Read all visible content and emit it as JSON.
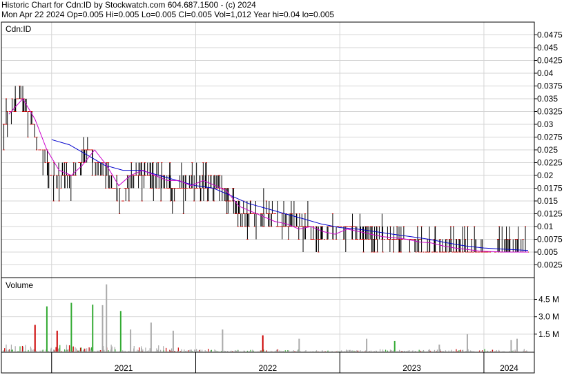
{
  "header": {
    "line1": "Historic Chart for Cdn:ID by Stockwatch.com 604.687.1500 - (c) 2024",
    "line2": "Mon Apr 22 2024   Op=0.005  Hi=0.005  Lo=0.005  Cl=0.005  Vol=1,012   Year hi=0.04   lo=0.005"
  },
  "chart_data": [
    {
      "type": "bar",
      "subtype": "ohlc-price",
      "title": "Cdn:ID",
      "ylim": [
        0,
        0.05
      ],
      "y_ticks": [
        "0.0475",
        "0.045",
        "0.0425",
        "0.04",
        "0.0375",
        "0.035",
        "0.0325",
        "0.03",
        "0.0275",
        "0.025",
        "0.0225",
        "0.02",
        "0.0175",
        "0.015",
        "0.0125",
        "0.01",
        "0.0075",
        "0.005",
        "0.0025"
      ],
      "y_tick_values": [
        0.0475,
        0.045,
        0.0425,
        0.04,
        0.0375,
        0.035,
        0.0325,
        0.03,
        0.0275,
        0.025,
        0.0225,
        0.02,
        0.0175,
        0.015,
        0.0125,
        0.01,
        0.0075,
        0.005,
        0.0025
      ],
      "x_start": "2020-09-01",
      "x_end": "2024-04-22",
      "grid": true,
      "colors": {
        "bars": "#000000",
        "close_marks": "#cc0000",
        "ma_short": "#cc00cc",
        "ma_long": "#0000cc"
      },
      "price_path": [
        [
          "2020-09-01",
          0.03
        ],
        [
          "2020-10-15",
          0.035
        ],
        [
          "2020-11-15",
          0.03
        ],
        [
          "2020-12-01",
          0.025
        ],
        [
          "2021-01-01",
          0.02
        ],
        [
          "2021-02-15",
          0.02
        ],
        [
          "2021-03-15",
          0.022
        ],
        [
          "2021-04-01",
          0.025
        ],
        [
          "2021-05-01",
          0.022
        ],
        [
          "2021-06-01",
          0.018
        ],
        [
          "2021-07-01",
          0.016
        ],
        [
          "2021-08-01",
          0.02
        ],
        [
          "2021-09-15",
          0.02
        ],
        [
          "2021-11-01",
          0.018
        ],
        [
          "2021-12-01",
          0.018
        ],
        [
          "2022-01-15",
          0.018
        ],
        [
          "2022-03-01",
          0.018
        ],
        [
          "2022-04-01",
          0.015
        ],
        [
          "2022-05-01",
          0.012
        ],
        [
          "2022-06-01",
          0.012
        ],
        [
          "2022-07-01",
          0.012
        ],
        [
          "2022-08-01",
          0.011
        ],
        [
          "2022-09-01",
          0.01
        ],
        [
          "2022-10-01",
          0.01
        ],
        [
          "2022-11-01",
          0.008
        ],
        [
          "2022-12-01",
          0.009
        ],
        [
          "2023-01-01",
          0.01
        ],
        [
          "2023-02-01",
          0.009
        ],
        [
          "2023-03-01",
          0.008
        ],
        [
          "2023-04-01",
          0.008
        ],
        [
          "2023-05-01",
          0.0075
        ],
        [
          "2023-06-01",
          0.007
        ],
        [
          "2023-07-01",
          0.007
        ],
        [
          "2023-08-01",
          0.006
        ],
        [
          "2023-09-01",
          0.006
        ],
        [
          "2023-10-01",
          0.0055
        ],
        [
          "2023-11-01",
          0.0055
        ],
        [
          "2023-12-01",
          0.005
        ],
        [
          "2024-01-01",
          0.005
        ],
        [
          "2024-02-01",
          0.005
        ],
        [
          "2024-03-01",
          0.005
        ],
        [
          "2024-04-22",
          0.005
        ]
      ],
      "ma_short_path": [
        [
          "2020-09-15",
          0.032
        ],
        [
          "2020-10-20",
          0.035
        ],
        [
          "2020-11-20",
          0.031
        ],
        [
          "2020-12-20",
          0.025
        ],
        [
          "2021-01-20",
          0.021
        ],
        [
          "2021-02-20",
          0.02
        ],
        [
          "2021-03-20",
          0.022
        ],
        [
          "2021-04-20",
          0.025
        ],
        [
          "2021-05-20",
          0.022
        ],
        [
          "2021-06-20",
          0.018
        ],
        [
          "2021-07-20",
          0.02
        ],
        [
          "2021-08-20",
          0.021
        ],
        [
          "2021-09-20",
          0.02
        ],
        [
          "2021-10-20",
          0.019
        ],
        [
          "2021-11-20",
          0.019
        ],
        [
          "2021-12-20",
          0.018
        ],
        [
          "2022-01-20",
          0.019
        ],
        [
          "2022-02-20",
          0.018
        ],
        [
          "2022-03-20",
          0.017
        ],
        [
          "2022-04-20",
          0.014
        ],
        [
          "2022-05-20",
          0.013
        ],
        [
          "2022-06-20",
          0.012
        ],
        [
          "2022-07-20",
          0.011
        ],
        [
          "2022-08-20",
          0.0105
        ],
        [
          "2022-09-20",
          0.0095
        ],
        [
          "2022-10-20",
          0.01
        ],
        [
          "2022-11-20",
          0.009
        ],
        [
          "2022-12-20",
          0.0085
        ],
        [
          "2023-01-20",
          0.0095
        ],
        [
          "2023-02-20",
          0.009
        ],
        [
          "2023-03-20",
          0.0085
        ],
        [
          "2023-04-20",
          0.008
        ],
        [
          "2023-05-20",
          0.0078
        ],
        [
          "2023-06-20",
          0.0075
        ],
        [
          "2023-07-20",
          0.007
        ],
        [
          "2023-08-20",
          0.0068
        ],
        [
          "2023-09-20",
          0.0062
        ],
        [
          "2023-10-20",
          0.0058
        ],
        [
          "2023-11-20",
          0.0055
        ],
        [
          "2023-12-20",
          0.0052
        ],
        [
          "2024-01-20",
          0.0051
        ],
        [
          "2024-02-20",
          0.005
        ],
        [
          "2024-03-20",
          0.005
        ],
        [
          "2024-04-22",
          0.005
        ]
      ],
      "ma_long_path": [
        [
          "2021-01-01",
          0.027
        ],
        [
          "2021-02-15",
          0.026
        ],
        [
          "2021-04-01",
          0.024
        ],
        [
          "2021-05-15",
          0.022
        ],
        [
          "2021-07-01",
          0.021
        ],
        [
          "2021-08-15",
          0.021
        ],
        [
          "2021-10-01",
          0.02
        ],
        [
          "2021-11-15",
          0.019
        ],
        [
          "2022-01-01",
          0.018
        ],
        [
          "2022-02-15",
          0.0175
        ],
        [
          "2022-04-01",
          0.016
        ],
        [
          "2022-05-15",
          0.0145
        ],
        [
          "2022-07-01",
          0.0135
        ],
        [
          "2022-08-15",
          0.0125
        ],
        [
          "2022-10-01",
          0.0115
        ],
        [
          "2022-11-15",
          0.0105
        ],
        [
          "2023-01-01",
          0.0098
        ],
        [
          "2023-02-15",
          0.0095
        ],
        [
          "2023-04-01",
          0.009
        ],
        [
          "2023-05-15",
          0.0085
        ],
        [
          "2023-07-01",
          0.008
        ],
        [
          "2023-08-15",
          0.0075
        ],
        [
          "2023-10-01",
          0.0068
        ],
        [
          "2023-11-15",
          0.0062
        ],
        [
          "2024-01-01",
          0.0058
        ],
        [
          "2024-02-15",
          0.0056
        ],
        [
          "2024-04-01",
          0.0054
        ],
        [
          "2024-04-22",
          0.0053
        ]
      ]
    },
    {
      "type": "bar",
      "subtype": "volume",
      "title": "Volume",
      "ylim": [
        0,
        6200000
      ],
      "y_ticks": [
        "4.5 M",
        "3.0 M",
        "1.5 M"
      ],
      "y_tick_values": [
        4500000,
        3000000,
        1500000
      ],
      "colors": {
        "up": "#33aa33",
        "down": "#cc0000",
        "flat": "#aaaaaa"
      },
      "spikes": [
        {
          "date": "2020-11-20",
          "value": 2300000,
          "dir": "down"
        },
        {
          "date": "2020-12-20",
          "value": 3900000,
          "dir": "up"
        },
        {
          "date": "2021-01-15",
          "value": 1800000,
          "dir": "down"
        },
        {
          "date": "2021-02-20",
          "value": 4200000,
          "dir": "up"
        },
        {
          "date": "2021-04-15",
          "value": 4050000,
          "dir": "up"
        },
        {
          "date": "2021-05-20",
          "value": 5800000,
          "dir": "flat"
        },
        {
          "date": "2021-05-10",
          "value": 4000000,
          "dir": "flat"
        },
        {
          "date": "2021-06-25",
          "value": 3500000,
          "dir": "up"
        },
        {
          "date": "2021-07-20",
          "value": 1900000,
          "dir": "flat"
        },
        {
          "date": "2021-09-10",
          "value": 2500000,
          "dir": "flat"
        },
        {
          "date": "2021-11-05",
          "value": 1800000,
          "dir": "flat"
        },
        {
          "date": "2022-03-10",
          "value": 1900000,
          "dir": "flat"
        },
        {
          "date": "2022-06-20",
          "value": 1400000,
          "dir": "down"
        },
        {
          "date": "2022-09-20",
          "value": 1100000,
          "dir": "flat"
        },
        {
          "date": "2023-03-10",
          "value": 1100000,
          "dir": "flat"
        },
        {
          "date": "2023-05-20",
          "value": 900000,
          "dir": "up"
        },
        {
          "date": "2023-09-10",
          "value": 600000,
          "dir": "flat"
        },
        {
          "date": "2023-11-20",
          "value": 1500000,
          "dir": "flat"
        },
        {
          "date": "2024-03-10",
          "value": 1000000,
          "dir": "flat"
        },
        {
          "date": "2024-03-25",
          "value": 1100000,
          "dir": "flat"
        }
      ]
    }
  ],
  "x_axis": {
    "year_labels": [
      "2021",
      "2022",
      "2023",
      "2024"
    ],
    "year_starts": [
      "2021-01-01",
      "2022-01-01",
      "2023-01-01",
      "2024-01-01"
    ]
  }
}
